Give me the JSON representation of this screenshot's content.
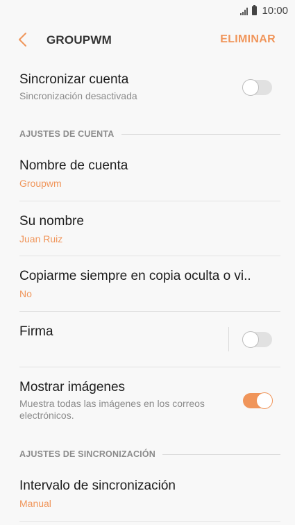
{
  "status_bar": {
    "time": "10:00"
  },
  "app_bar": {
    "title": "GROUPWM",
    "action": "ELIMINAR"
  },
  "sync_account": {
    "title": "Sincronizar cuenta",
    "subtitle": "Sincronización desactivada",
    "enabled": false
  },
  "account_section": {
    "header": "AJUSTES DE CUENTA",
    "account_name": {
      "title": "Nombre de cuenta",
      "value": "Groupwm"
    },
    "your_name": {
      "title": "Su nombre",
      "value": "Juan Ruiz"
    },
    "always_bcc": {
      "title": "Copiarme siempre en copia oculta o vi..",
      "value": "No"
    },
    "signature": {
      "title": "Firma",
      "enabled": false
    },
    "show_images": {
      "title": "Mostrar imágenes",
      "subtitle": "Muestra todas las imágenes en los correos electrónicos.",
      "enabled": true
    }
  },
  "sync_section": {
    "header": "AJUSTES DE SINCRONIZACIÓN",
    "sync_interval": {
      "title": "Intervalo de sincronización",
      "value": "Manual"
    }
  },
  "colors": {
    "accent": "#f0955a",
    "background": "#f8f8f8",
    "divider": "#e2e2e2"
  }
}
